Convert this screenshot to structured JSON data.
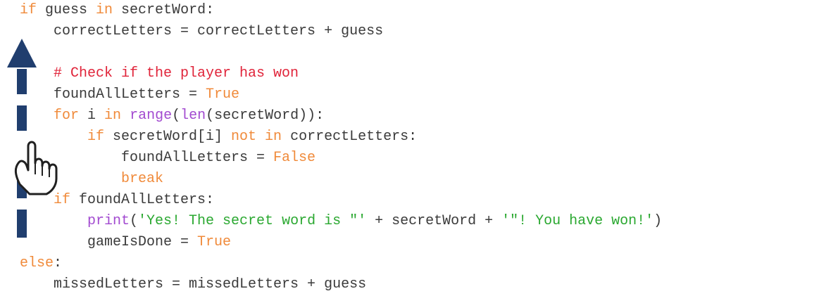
{
  "colors": {
    "keyword": "#f08a3a",
    "builtin": "#a24ad0",
    "comment": "#e0243a",
    "string": "#2aa830",
    "default": "#3a3a3a",
    "arrow": "#203e6e"
  },
  "icons": [
    "arrow-up-icon",
    "pointing-hand-icon"
  ],
  "code": {
    "lines": [
      {
        "indent": 0,
        "tokens": [
          {
            "t": "if",
            "k": "kw"
          },
          {
            "t": " guess ",
            "k": "id"
          },
          {
            "t": "in",
            "k": "kw"
          },
          {
            "t": " secretWord:",
            "k": "id"
          }
        ]
      },
      {
        "indent": 4,
        "tokens": [
          {
            "t": "correctLetters = correctLetters + guess",
            "k": "id"
          }
        ]
      },
      {
        "indent": 0,
        "tokens": []
      },
      {
        "indent": 4,
        "tokens": [
          {
            "t": "# Check if the player has won",
            "k": "com"
          }
        ]
      },
      {
        "indent": 4,
        "tokens": [
          {
            "t": "foundAllLetters = ",
            "k": "id"
          },
          {
            "t": "True",
            "k": "kw"
          }
        ]
      },
      {
        "indent": 4,
        "tokens": [
          {
            "t": "for",
            "k": "kw"
          },
          {
            "t": " i ",
            "k": "id"
          },
          {
            "t": "in",
            "k": "kw"
          },
          {
            "t": " ",
            "k": "id"
          },
          {
            "t": "range",
            "k": "bi"
          },
          {
            "t": "(",
            "k": "id"
          },
          {
            "t": "len",
            "k": "bi"
          },
          {
            "t": "(secretWord)):",
            "k": "id"
          }
        ]
      },
      {
        "indent": 8,
        "tokens": [
          {
            "t": "if",
            "k": "kw"
          },
          {
            "t": " secretWord[i] ",
            "k": "id"
          },
          {
            "t": "not in",
            "k": "kw"
          },
          {
            "t": " correctLetters:",
            "k": "id"
          }
        ]
      },
      {
        "indent": 12,
        "tokens": [
          {
            "t": "foundAllLetters = ",
            "k": "id"
          },
          {
            "t": "False",
            "k": "kw"
          }
        ]
      },
      {
        "indent": 12,
        "tokens": [
          {
            "t": "break",
            "k": "kw"
          }
        ]
      },
      {
        "indent": 4,
        "tokens": [
          {
            "t": "if",
            "k": "kw"
          },
          {
            "t": " foundAllLetters:",
            "k": "id"
          }
        ]
      },
      {
        "indent": 8,
        "tokens": [
          {
            "t": "print",
            "k": "bi"
          },
          {
            "t": "(",
            "k": "id"
          },
          {
            "t": "'Yes! The secret word is \"'",
            "k": "str"
          },
          {
            "t": " + secretWord + ",
            "k": "id"
          },
          {
            "t": "'\"! You have won!'",
            "k": "str"
          },
          {
            "t": ")",
            "k": "id"
          }
        ]
      },
      {
        "indent": 8,
        "tokens": [
          {
            "t": "gameIsDone = ",
            "k": "id"
          },
          {
            "t": "True",
            "k": "kw"
          }
        ]
      },
      {
        "indent": 0,
        "tokens": [
          {
            "t": "else",
            "k": "kw"
          },
          {
            "t": ":",
            "k": "id"
          }
        ]
      },
      {
        "indent": 4,
        "tokens": [
          {
            "t": "missedLetters = missedLetters + guess",
            "k": "id"
          }
        ]
      }
    ]
  }
}
